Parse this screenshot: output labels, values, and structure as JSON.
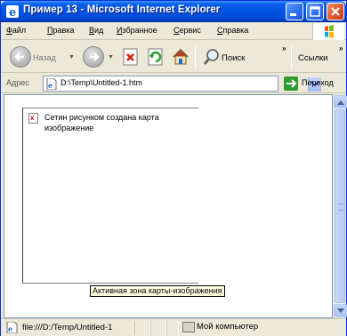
{
  "window": {
    "title": "Пример 13 - Microsoft Internet Explorer"
  },
  "menu": {
    "items": [
      {
        "u": "Ф",
        "rest": "айл"
      },
      {
        "u": "П",
        "rest": "равка"
      },
      {
        "u": "В",
        "rest": "ид"
      },
      {
        "u": "И",
        "rest": "збранное"
      },
      {
        "u": "С",
        "rest": "ервис"
      },
      {
        "u": "С",
        "rest": "правка"
      }
    ]
  },
  "toolbar": {
    "back_label": "Назад",
    "search_label": "Поиск",
    "links_label": "Ссылки",
    "chevron": "»"
  },
  "address": {
    "label": "Адрес",
    "value": "D:\\Temp\\Untitled-1.htm",
    "go_label": "Переход"
  },
  "content": {
    "alt_text": "Сетин рисунком создана карта изображение",
    "tooltip": "Активная зона карты-изображения"
  },
  "status": {
    "text": "file:///D:/Temp/Untitled-1",
    "zone": "Мой компьютер"
  },
  "colors": {
    "titlebar": "#0054e3",
    "close_button": "#e0562b",
    "tooltip_bg": "#ffffe1",
    "go_green": "#2e9c2e"
  }
}
